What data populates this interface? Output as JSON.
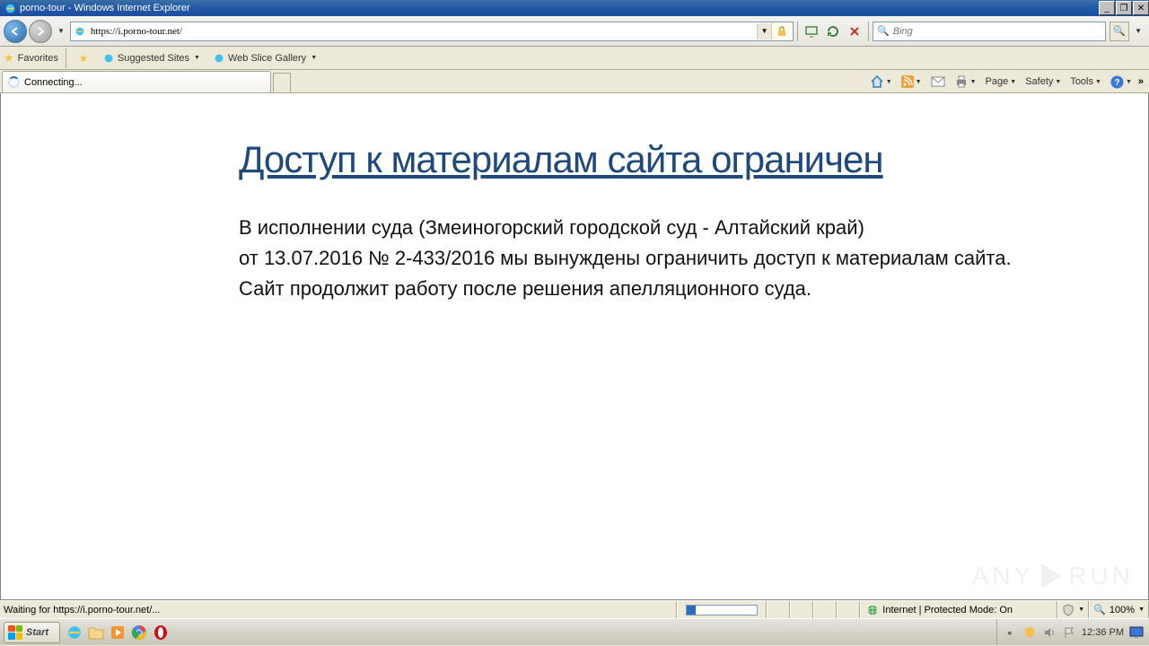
{
  "titlebar": {
    "title": "porno-tour - Windows Internet Explorer"
  },
  "navbar": {
    "url": "https://i.porno-tour.net/",
    "search_placeholder": "Bing"
  },
  "favbar": {
    "label": "Favorites",
    "items": [
      {
        "label": "Suggested Sites"
      },
      {
        "label": "Web Slice Gallery"
      }
    ]
  },
  "tab": {
    "label": "Connecting..."
  },
  "cmdbar": {
    "page": "Page",
    "safety": "Safety",
    "tools": "Tools"
  },
  "content": {
    "heading": "Доступ к материалам сайта ограничен",
    "line1": "В исполнении суда (Змеиногорский городской суд - Алтайский край)",
    "line2": "от 13.07.2016  № 2-433/2016 мы вынуждены ограничить доступ к материалам сайта.",
    "line3": "Сайт продолжит работу после решения апелляционного суда."
  },
  "watermark": {
    "text": "ANY",
    "text2": "RUN"
  },
  "statusbar": {
    "msg": "Waiting for https://i.porno-tour.net/...",
    "zone": "Internet | Protected Mode: On",
    "zoom": "100%"
  },
  "taskbar": {
    "start": "Start",
    "clock": "12:36 PM"
  }
}
